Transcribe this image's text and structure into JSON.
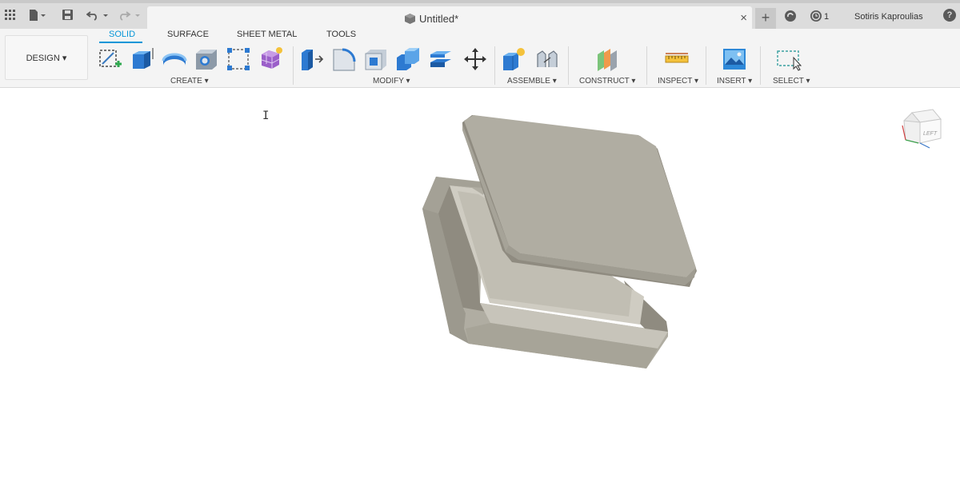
{
  "titlebar": {
    "doc_title": "Untitled*",
    "jobs_count": "1",
    "user_name": "Sotiris Kaproulias",
    "close_glyph": "×",
    "new_tab_glyph": "+",
    "help_glyph": "?"
  },
  "toolbar": {
    "workspace_label": "DESIGN ▾",
    "tabs": [
      {
        "label": "SOLID",
        "active": true
      },
      {
        "label": "SURFACE",
        "active": false
      },
      {
        "label": "SHEET METAL",
        "active": false
      },
      {
        "label": "TOOLS",
        "active": false
      }
    ],
    "groups": {
      "create": "CREATE ▾",
      "modify": "MODIFY ▾",
      "assemble": "ASSEMBLE ▾",
      "construct": "CONSTRUCT ▾",
      "inspect": "INSPECT ▾",
      "insert": "INSERT ▾",
      "select": "SELECT ▾"
    },
    "icons": {
      "create": [
        "create-sketch-icon",
        "extrude-icon",
        "revolve-icon",
        "hole-icon",
        "pattern-icon",
        "create-form-icon"
      ],
      "modify": [
        "press-pull-icon",
        "fillet-icon",
        "shell-icon",
        "combine-icon",
        "offset-face-icon",
        "move-icon"
      ],
      "assemble": [
        "new-component-icon",
        "joint-icon"
      ],
      "construct": [
        "offset-plane-icon"
      ],
      "inspect": [
        "measure-icon"
      ],
      "insert": [
        "insert-image-icon"
      ],
      "select": [
        "select-window-icon"
      ]
    }
  },
  "viewcube": {
    "face_label": "LEFT"
  },
  "colors": {
    "accent": "#0696d7",
    "model_face": "#b0ada2",
    "model_dark": "#8f8b80",
    "model_light": "#c7c4ba"
  }
}
